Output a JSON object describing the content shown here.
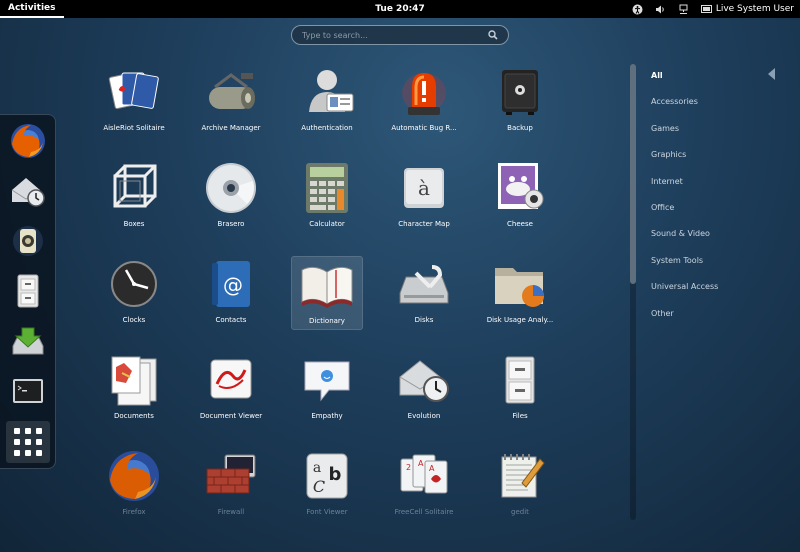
{
  "topbar": {
    "activities": "Activities",
    "clock": "Tue 20:47",
    "user": "Live System User"
  },
  "search": {
    "placeholder": "Type to search..."
  },
  "dash": {
    "items": [
      "firefox-icon",
      "evolution-icon",
      "rhythmbox-icon",
      "files-icon",
      "software-install-icon",
      "terminal-icon"
    ],
    "show_apps": "show-applications-icon"
  },
  "apps": [
    {
      "label": "AisleRiot Solitaire",
      "icon": "cards-icon"
    },
    {
      "label": "Archive Manager",
      "icon": "archive-icon"
    },
    {
      "label": "Authentication",
      "icon": "authentication-icon"
    },
    {
      "label": "Automatic Bug R...",
      "icon": "alarm-icon"
    },
    {
      "label": "Backup",
      "icon": "safe-icon"
    },
    {
      "label": "Boxes",
      "icon": "boxes-icon"
    },
    {
      "label": "Brasero",
      "icon": "disc-icon"
    },
    {
      "label": "Calculator",
      "icon": "calculator-icon"
    },
    {
      "label": "Character Map",
      "icon": "character-map-icon"
    },
    {
      "label": "Cheese",
      "icon": "cheese-icon"
    },
    {
      "label": "Clocks",
      "icon": "clock-icon"
    },
    {
      "label": "Contacts",
      "icon": "contacts-icon"
    },
    {
      "label": "Dictionary",
      "icon": "book-icon"
    },
    {
      "label": "Disks",
      "icon": "disks-icon"
    },
    {
      "label": "Disk Usage Analy...",
      "icon": "folder-chart-icon"
    },
    {
      "label": "Documents",
      "icon": "documents-icon"
    },
    {
      "label": "Document Viewer",
      "icon": "document-viewer-icon"
    },
    {
      "label": "Empathy",
      "icon": "chat-icon"
    },
    {
      "label": "Evolution",
      "icon": "evolution-icon"
    },
    {
      "label": "Files",
      "icon": "filing-cabinet-icon"
    },
    {
      "label": "Firefox",
      "icon": "firefox-icon"
    },
    {
      "label": "Firewall",
      "icon": "firewall-icon"
    },
    {
      "label": "Font Viewer",
      "icon": "font-icon"
    },
    {
      "label": "FreeCell Solitaire",
      "icon": "cards-icon"
    },
    {
      "label": "gedit",
      "icon": "text-editor-icon"
    }
  ],
  "categories": [
    {
      "label": "All",
      "active": true
    },
    {
      "label": "Accessories"
    },
    {
      "label": "Games"
    },
    {
      "label": "Graphics"
    },
    {
      "label": "Internet"
    },
    {
      "label": "Office"
    },
    {
      "label": "Sound & Video"
    },
    {
      "label": "System Tools"
    },
    {
      "label": "Universal Access"
    },
    {
      "label": "Other"
    }
  ],
  "colors": {
    "background": "#1d3d5a",
    "panel": "#000000",
    "text": "#ffffff"
  }
}
